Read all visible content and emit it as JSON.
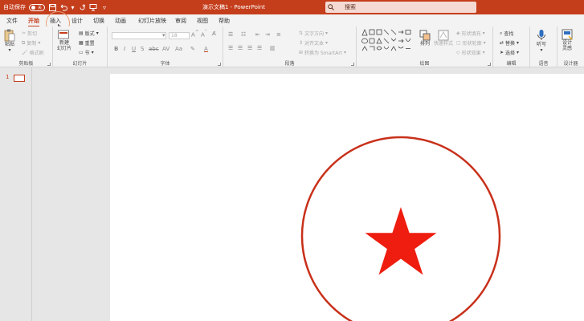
{
  "titlebar": {
    "autosave_label": "自动保存",
    "autosave_state": "关",
    "doc_title": "演示文稿1 - PowerPoint",
    "search_placeholder": "搜索"
  },
  "tabs": [
    {
      "label": "文件"
    },
    {
      "label": "开始"
    },
    {
      "label": "插入"
    },
    {
      "label": "设计"
    },
    {
      "label": "切换"
    },
    {
      "label": "动画"
    },
    {
      "label": "幻灯片放映"
    },
    {
      "label": "审阅"
    },
    {
      "label": "视图"
    },
    {
      "label": "帮助"
    }
  ],
  "active_tab": "开始",
  "ribbon": {
    "clipboard": {
      "label": "剪贴板",
      "paste": "粘贴",
      "cut": "剪切",
      "copy": "复制",
      "format_painter": "格式刷"
    },
    "slides": {
      "label": "幻灯片",
      "new_slide_1": "新建",
      "new_slide_2": "幻灯片",
      "layout": "版式",
      "reset": "重置",
      "section": "节"
    },
    "font": {
      "label": "字体",
      "font_size": "18"
    },
    "paragraph": {
      "label": "段落",
      "text_direction": "文字方向",
      "align_text": "对齐文本",
      "smartart": "转换为 SmartArt"
    },
    "drawing": {
      "label": "绘图",
      "arrange": "排列",
      "quick_styles_1": "快速样式",
      "shape_fill": "形状填充",
      "shape_outline": "形状轮廓",
      "shape_effects": "形状效果"
    },
    "editing": {
      "label": "编辑",
      "find": "查找",
      "replace": "替换",
      "select": "选择"
    },
    "voice": {
      "label": "语音",
      "dictate": "听写"
    },
    "designer": {
      "label": "设计器",
      "design_ideas_1": "设计",
      "design_ideas_2": "灵感"
    }
  },
  "thumbnails": [
    {
      "number": "1"
    }
  ],
  "colors": {
    "accent": "#c43e1c",
    "star": "#ee1d0f",
    "circle": "#c8301a"
  }
}
